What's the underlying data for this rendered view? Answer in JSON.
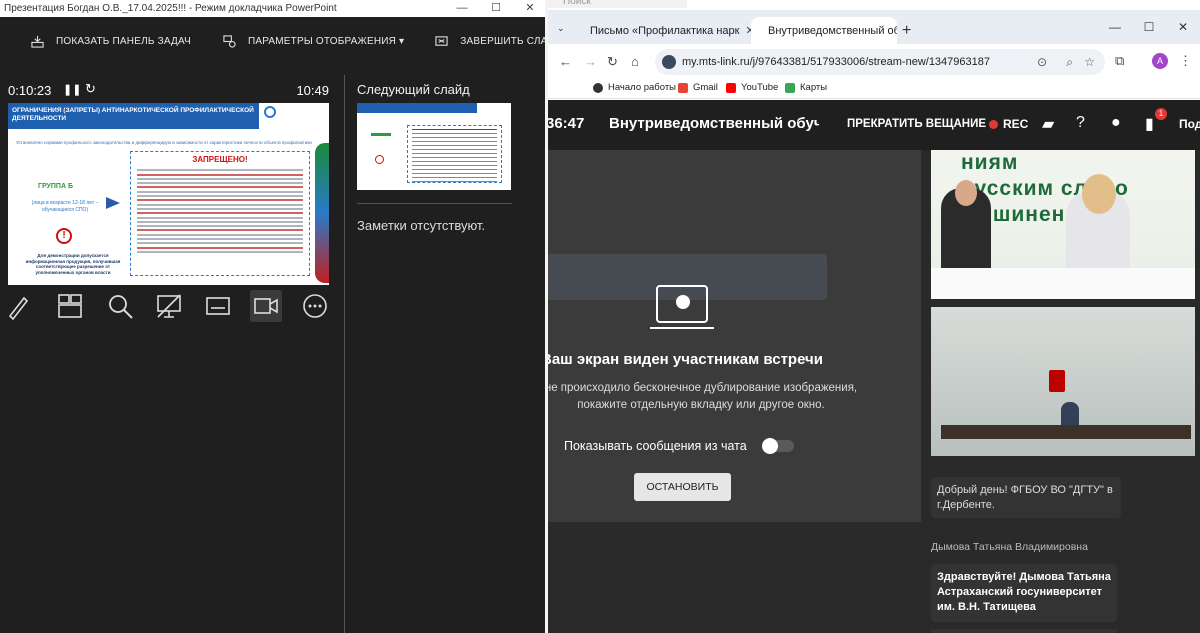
{
  "powerpoint": {
    "window_title": "Презентация Богдан О.В._17.04.2025!!! - Режим докладчика PowerPoint",
    "toolbar": {
      "taskbar_label": "ПОКАЗАТЬ ПАНЕЛЬ ЗАДАЧ",
      "display_settings_label": "ПАРАМЕТРЫ ОТОБРАЖЕНИЯ ▾",
      "end_show_label": "ЗАВЕРШИТЬ СЛАЙД-ШОУ"
    },
    "elapsed_time": "0:10:23",
    "clock": "10:49",
    "current_slide": {
      "header": "ОГРАНИЧЕНИЯ (ЗАПРЕТЫ) АНТИНАРКОТИЧЕСКОЙ ПРОФИЛАКТИЧЕСКОЙ ДЕЯТЕЛЬНОСТИ",
      "subtitle": "Установлено нормами профильного законодательства и дифференцирую в зависимости от характеристики личности объекта профилактики",
      "group_title": "ГРУППА Б",
      "group_subtitle": "(лица в возрасте 12-18 лет – обучающиеся СПО)",
      "forbidden_title": "ЗАПРЕЩЕНО!",
      "footer": "Для демонстрации допускается информационная продукция, получившая соответствующее разрешение от уполномоченных органов власти"
    },
    "next_slide_label": "Следующий слайд",
    "notes_text": "Заметки отсутствуют."
  },
  "browser": {
    "taskbar_search": "Поиск",
    "tabs": [
      {
        "title": "Письмо «Профилактика нарк"
      },
      {
        "title": "Внутриведомственный об"
      }
    ],
    "url": "my.mts-link.ru/j/97643381/517933006/stream-new/1347963187",
    "bookmarks": [
      {
        "label": "Начало работы"
      },
      {
        "label": "Gmail"
      },
      {
        "label": "YouTube"
      },
      {
        "label": "Карты"
      }
    ],
    "avatar_letter": "A"
  },
  "meeting": {
    "time": ":36:47",
    "title": "Внутриведомственный обуч",
    "stop_broadcast": "ПРЕКРАТИТЬ ВЕЩАНИЕ",
    "rec_label": "REC",
    "notification_count": "1",
    "more_label": "Под",
    "screen_shared_title": "Ваш экран виден участникам встречи",
    "screen_shared_hint": "не происходило бесконечное дублирование изображения, покажите отдельную вкладку или другое окно.",
    "show_chat_label": "Показывать сообщения из чата",
    "stop_button": "ОСТАНОВИТЬ",
    "chat": [
      {
        "author": "",
        "text": "Добрый день! ФГБОУ ВО \"ДГТУ\" в г.Дербенте."
      },
      {
        "author": "Дымова Татьяна Владимировна",
        "text": "Здравствуйте!  Дымова Татьяна Астраханский госуниверситет им. В.Н. Татищева"
      }
    ]
  }
}
